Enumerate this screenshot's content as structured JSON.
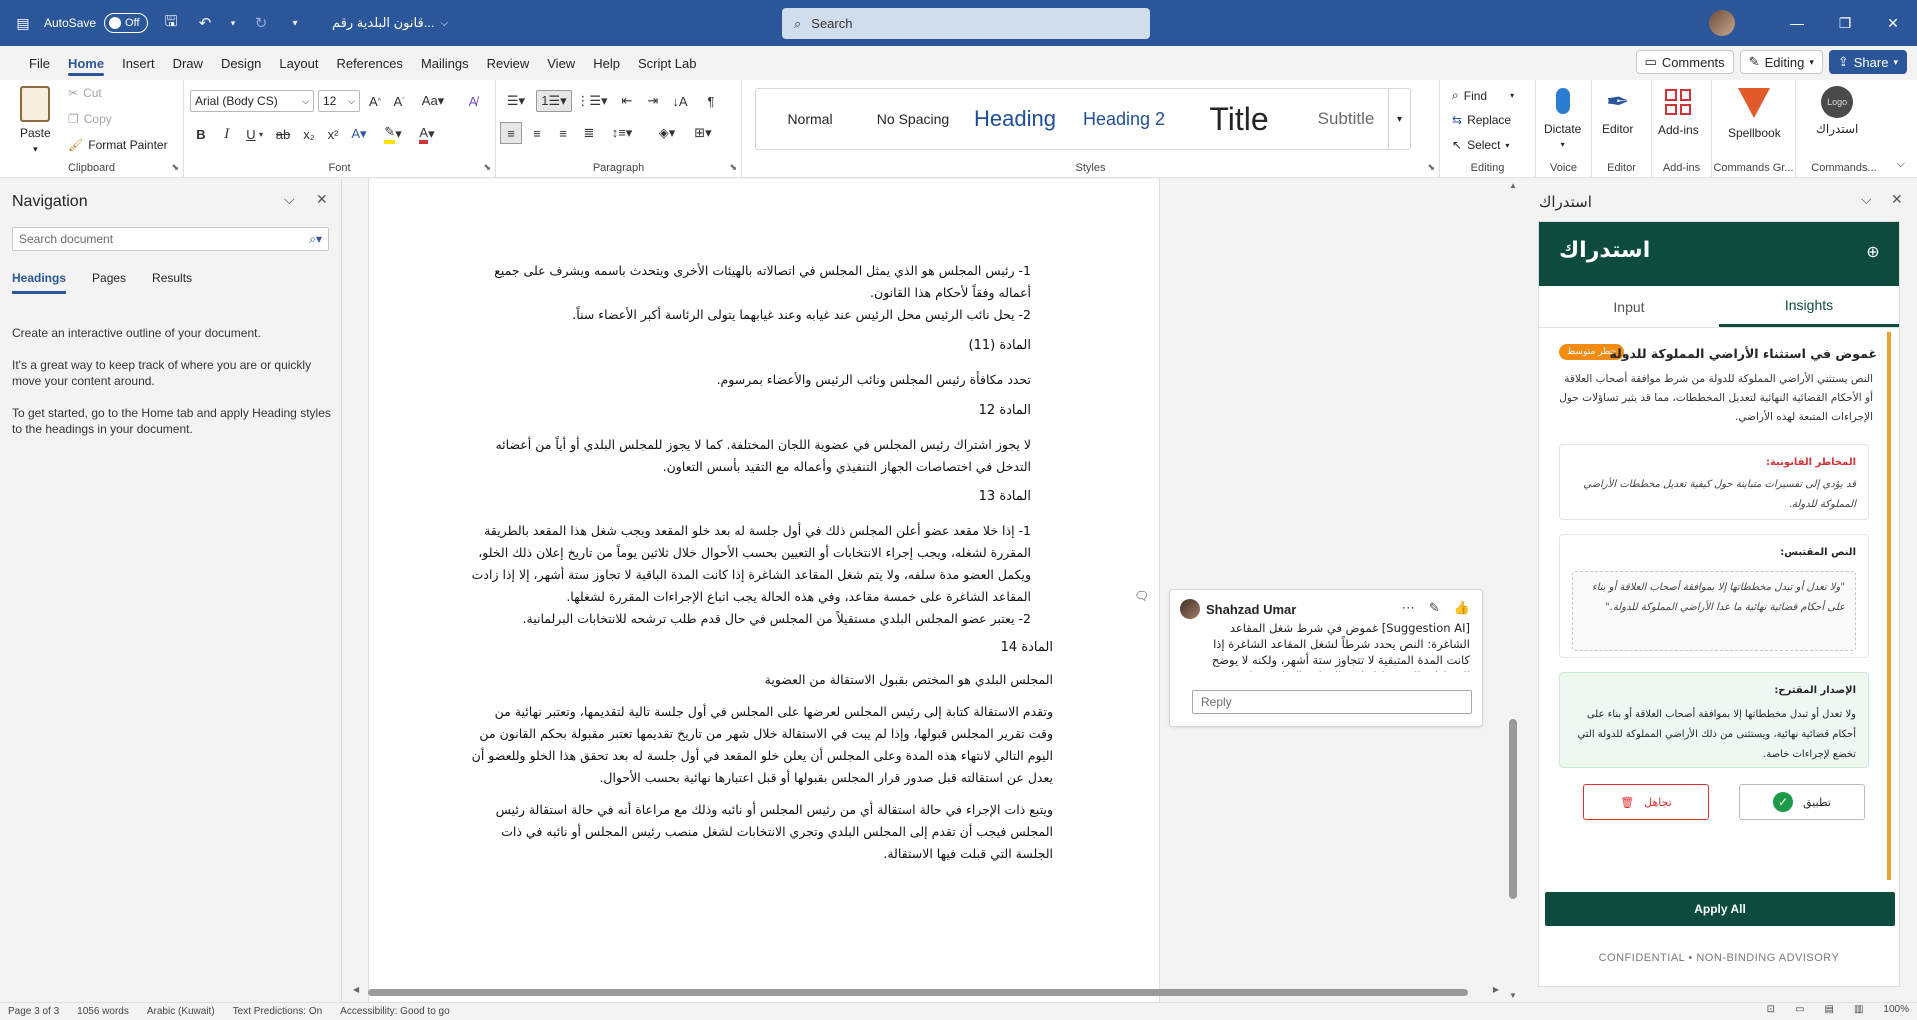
{
  "titlebar": {
    "autosave_label": "AutoSave",
    "autosave_state": "Off",
    "doc_name": "قانون البلدية رقم...",
    "search_placeholder": "Search"
  },
  "menu": {
    "tabs": [
      "File",
      "Home",
      "Insert",
      "Draw",
      "Design",
      "Layout",
      "References",
      "Mailings",
      "Review",
      "View",
      "Help",
      "Script Lab"
    ],
    "active_tab": "Home",
    "comments_label": "Comments",
    "editing_label": "Editing",
    "share_label": "Share"
  },
  "ribbon": {
    "clipboard": {
      "paste": "Paste",
      "cut": "Cut",
      "copy": "Copy",
      "format_painter": "Format Painter",
      "label": "Clipboard"
    },
    "font": {
      "font_name": "Arial (Body CS)",
      "font_size": "12",
      "label": "Font"
    },
    "paragraph": {
      "label": "Paragraph"
    },
    "styles": {
      "items": [
        "Normal",
        "No Spacing",
        "Heading",
        "Heading 2",
        "Title",
        "Subtitle"
      ],
      "label": "Styles"
    },
    "editing": {
      "find": "Find",
      "replace": "Replace",
      "select": "Select",
      "label": "Editing"
    },
    "voice": {
      "dictate": "Dictate",
      "label": "Voice"
    },
    "editor": {
      "editor": "Editor",
      "label": "Editor"
    },
    "addins": {
      "addins": "Add-ins",
      "label": "Add-ins"
    },
    "commands_group": {
      "spellbook": "Spellbook",
      "label": "Commands Gr..."
    },
    "commands": {
      "istidrak": "استدراك",
      "label": "Commands...",
      "logo_text": "Logo"
    }
  },
  "navigation": {
    "title": "Navigation",
    "search_placeholder": "Search document",
    "tabs": [
      "Headings",
      "Pages",
      "Results"
    ],
    "active_tab": "Headings",
    "help": [
      "Create an interactive outline of your document.",
      "It's a great way to keep track of where you are or quickly move your content around.",
      "To get started, go to the Home tab and apply Heading styles to the headings in your document."
    ]
  },
  "document": {
    "p1": "1-  رئيس المجلس هو الذي يمثل المجلس في اتصالاته بالهيئات الأخرى ويتحدث باسمه ويشرف على جميع أعماله وفقاً لأحكام هذا القانون.",
    "p2": "2-  يحل نائب الرئيس محل الرئيس عند غيابه وعند غيابهما يتولى الرئاسة أكبر الأعضاء سناً.",
    "h11": "المادة (11)",
    "p3": "تحدد مكافأة رئيس المجلس ونائب الرئيس والأعضاء بمرسوم.",
    "h12": "المادة 12",
    "p4": "لا يجوز اشتراك رئيس المجلس في عضوية اللجان المختلفة. كما لا يجوز للمجلس البلدي أو أياً من أعضائه التدخل في اختصاصات الجهاز التنفيذي وأعماله مع التقيد بأسس التعاون.",
    "h13": "المادة 13",
    "p5": "1-  إذا خلا مقعد عضو أعلن المجلس ذلك في أول جلسة له بعد خلو المقعد ويجب شغل هذا المقعد بالطريقة المقررة لشغله، ويجب إجراء الانتخابات أو التعيين بحسب الأحوال خلال ثلاثين يوماً من تاريخ إعلان ذلك الخلو، ويكمل العضو مدة سلفه، ولا يتم شغل المقاعد الشاغرة إذا كانت المدة الباقية لا تجاوز ستة أشهر، إلا إذا زادت المقاعد الشاغرة على خمسة مقاعد، وفي هذه الحالة يجب اتباع الإجراءات المقررة لشغلها.",
    "p6": "2-  يعتبر عضو المجلس البلدي مستقيلاً من المجلس في حال قدم طلب ترشحه للانتخابات البرلمانية.",
    "h14": "المادة 14",
    "p7": "المجلس البلدي هو المختص بقبول الاستقالة من العضوية",
    "p8": "وتقدم الاستقالة كتابة إلى رئيس المجلس لعرضها على المجلس في أول جلسة تالية لتقديمها، وتعتبر نهائية من وقت تقرير المجلس قبولها، وإذا لم يبت في الاستقالة خلال شهر من تاريخ تقديمها تعتبر مقبولة بحكم القانون من اليوم التالي لانتهاء هذه المدة وعلى المجلس أن يعلن خلو المقعد في أول جلسة له بعد تحقق هذا الخلو وللعضو أن يعدل عن استقالته قبل صدور قرار المجلس بقبولها أو قبل اعتبارها نهائية بحسب الأحوال.",
    "p9": "ويتبع ذات الإجراء في حالة استقالة أي من رئيس المجلس أو نائبه وذلك مع مراعاة أنه في حالة استقالة رئيس المجلس فيجب أن تقدم إلى المجلس البلدي وتجري الانتخابات لشغل منصب رئيس المجلس أو نائبه في ذات الجلسة التي قبلت فيها الاستقالة."
  },
  "comment": {
    "author": "Shahzad Umar",
    "body": "[Suggestion AI] غموض في شرط شغل المقاعد الشاغرة: النص يحدد شرطاً لشغل المقاعد الشاغرة إذا كانت المدة المتبقية لا تتجاوز ستة أشهر، ولكنه لا يوضح الإجراءات المتبعة إذا زادت المقاعد الشاغرة على خمسة.",
    "reply_placeholder": "Reply"
  },
  "addin": {
    "pane_title": "استدراك",
    "brand": "استدراك",
    "tabs": [
      "Input",
      "Insights"
    ],
    "active_tab": "Insights",
    "insight": {
      "title": "غموض في استثناء الأراضي المملوكة للدولة",
      "badge": "خطر متوسط",
      "summary": "النص يستثني الأراضي المملوكة للدولة من شرط موافقة أصحاب العلاقة أو الأحكام القضائية النهائية لتعديل المخططات، مما قد يثير تساؤلات حول الإجراءات المتبعة لهذه الأراضي.",
      "risk_label": "المخاطر القانونية:",
      "risk_body": "قد يؤدي إلى تفسيرات متباينة حول كيفية تعديل مخططات الأراضي المملوكة للدولة.",
      "quote_label": "النص المقتبس:",
      "quote_body": "\"ولا تعدل أو تبدل مخططاتها إلا بموافقة أصحاب العلاقة أو بناء على أحكام قضائية نهائية ما عدا الأراضي المملوكة للدولة.\"",
      "suggest_label": "الإصدار المقترح:",
      "suggest_body": "ولا تعدل أو تبدل مخططاتها إلا بموافقة أصحاب العلاقة أو بناء على أحكام قضائية نهائية، ويستثنى من ذلك الأراضي المملوكة للدولة التي تخضع لإجراءات خاصة.",
      "ignore_label": "تجاهل",
      "apply_label": "تطبيق"
    },
    "apply_all": "Apply All",
    "footer": "CONFIDENTIAL • NON-BINDING ADVISORY"
  },
  "status": {
    "page": "Page 3 of 3",
    "words": "1056 words",
    "language": "Arabic (Kuwait)",
    "predictions": "Text Predictions: On",
    "accessibility": "Accessibility: Good to go",
    "zoom": "100%"
  },
  "colors": {
    "word_blue": "#2b579a",
    "brand_green": "#0d4b3e",
    "badge_orange": "#f28c12",
    "accent_orange": "#f0a030"
  }
}
